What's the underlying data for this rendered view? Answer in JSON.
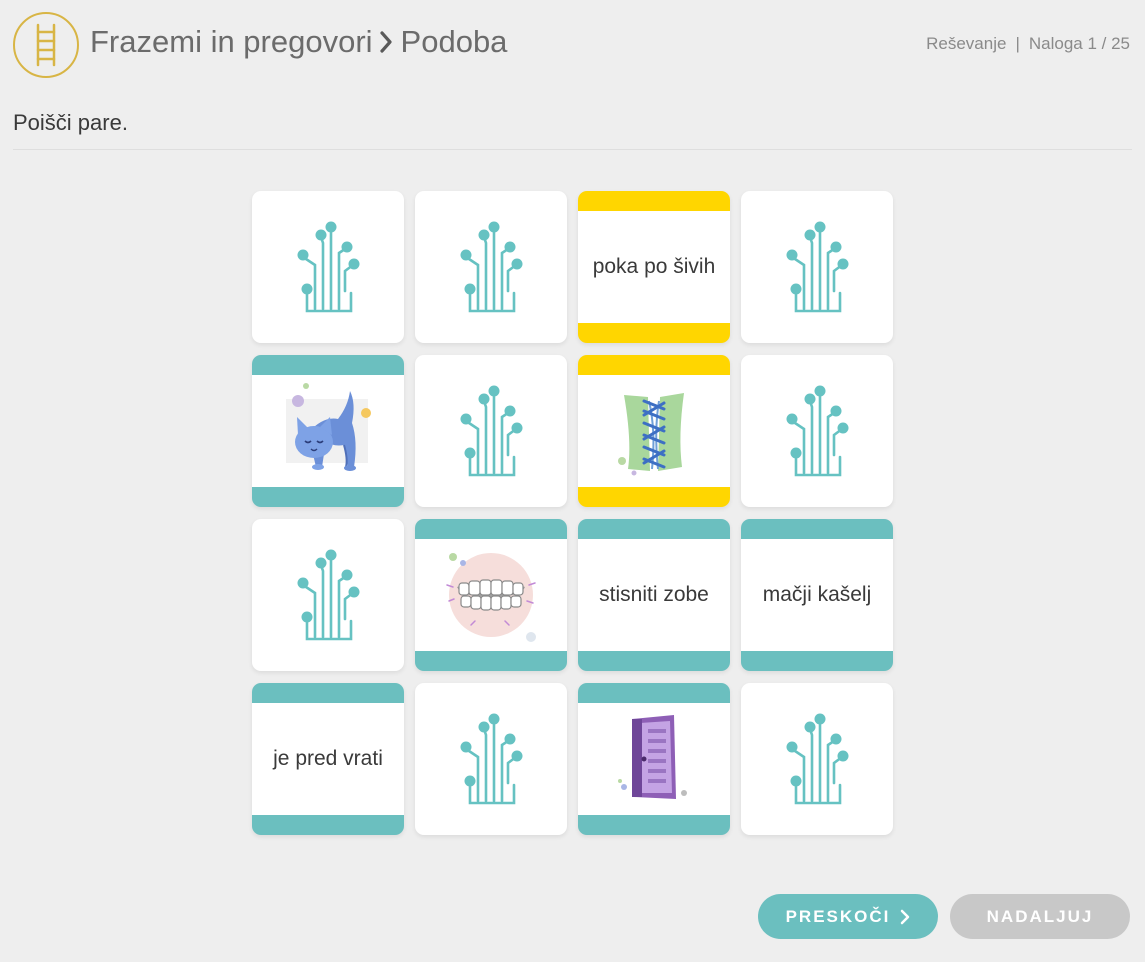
{
  "header": {
    "title_part1": "Frazemi in pregovori",
    "title_part2": "Podoba",
    "status_mode": "Reševanje",
    "status_separator": "|",
    "status_task": "Naloga 1 / 25"
  },
  "instruction": "Poišči pare.",
  "cards": [
    {
      "state": "hidden",
      "icon": "circuit-icon"
    },
    {
      "state": "hidden",
      "icon": "circuit-icon"
    },
    {
      "state": "revealed-yellow",
      "text": "poka po šivih"
    },
    {
      "state": "hidden",
      "icon": "circuit-icon"
    },
    {
      "state": "revealed-teal",
      "icon": "cat-icon"
    },
    {
      "state": "hidden",
      "icon": "circuit-icon"
    },
    {
      "state": "revealed-yellow",
      "icon": "torn-seam-icon"
    },
    {
      "state": "hidden",
      "icon": "circuit-icon"
    },
    {
      "state": "hidden",
      "icon": "circuit-icon"
    },
    {
      "state": "revealed-teal",
      "icon": "teeth-icon"
    },
    {
      "state": "revealed-teal",
      "text": "stisniti zobe"
    },
    {
      "state": "revealed-teal",
      "text": "mačji kašelj"
    },
    {
      "state": "revealed-teal",
      "text": "je pred vrati"
    },
    {
      "state": "hidden",
      "icon": "circuit-icon"
    },
    {
      "state": "revealed-teal",
      "icon": "door-icon"
    },
    {
      "state": "hidden",
      "icon": "circuit-icon"
    }
  ],
  "buttons": {
    "skip_label": "PRESKOČI",
    "continue_label": "NADALJUJ"
  },
  "colors": {
    "accent_teal": "#6bbfbf",
    "accent_yellow": "#ffd600",
    "logo_gold": "#d8b545",
    "button_disabled": "#c8c8c8"
  }
}
